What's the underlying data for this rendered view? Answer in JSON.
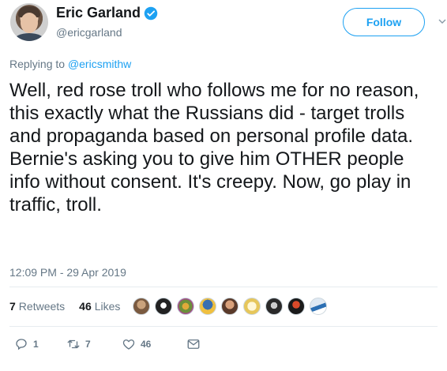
{
  "tweet": {
    "author": {
      "name": "Eric Garland",
      "handle": "@ericgarland",
      "avatar_icon": "profile-photo"
    },
    "follow_label": "Follow",
    "replying_to_prefix": "Replying to",
    "replying_to_handle": "@ericsmithw",
    "text": "Well, red rose troll who follows me for no reason, this exactly what the Russians did - target trolls and propaganda based on personal profile data. Bernie's asking you to give him OTHER people info without consent. It's creepy. Now, go play in traffic, troll.",
    "timestamp": "12:09 PM - 29 Apr 2019",
    "stats": {
      "retweets_count": "7",
      "retweets_label": "Retweets",
      "likes_count": "46",
      "likes_label": "Likes"
    },
    "actions": {
      "reply_count": "1",
      "retweet_count": "7",
      "like_count": "46"
    }
  },
  "colors": {
    "accent": "#1da1f2",
    "secondary_text": "#657786",
    "primary_text": "#14171a"
  }
}
